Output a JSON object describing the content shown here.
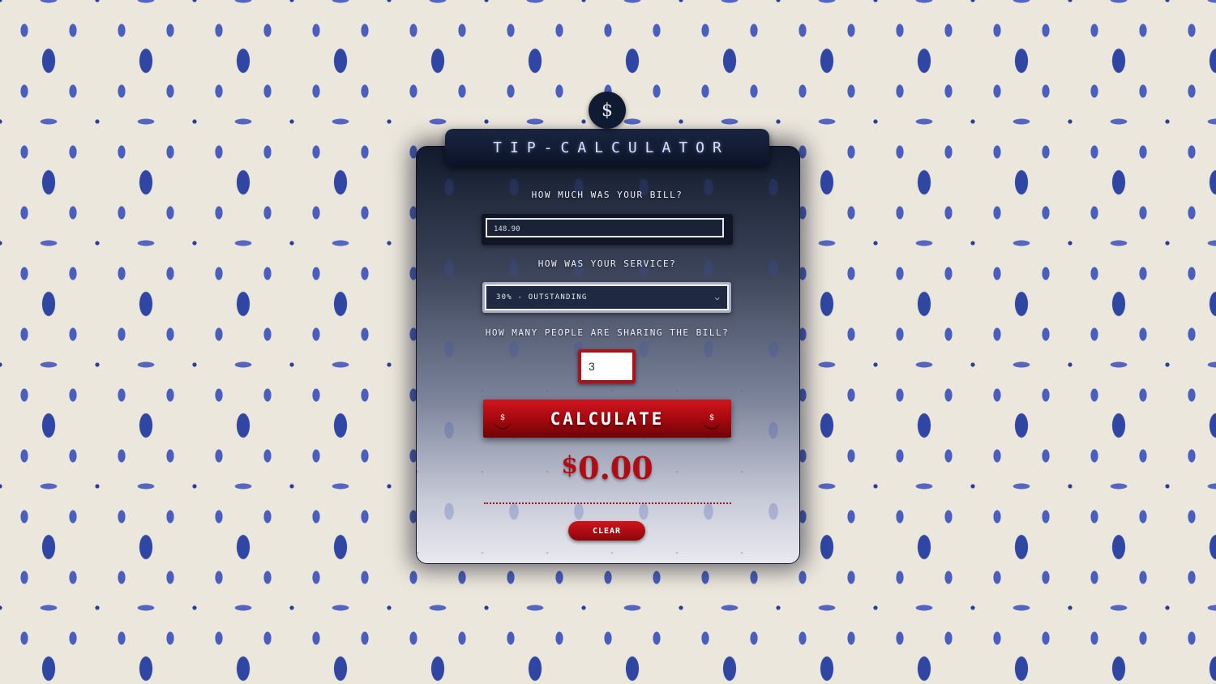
{
  "app": {
    "title": "Tip-Calculator",
    "logo_icon": "dollar-coin-icon",
    "logo_symbol": "$"
  },
  "form": {
    "bill_label": "How much was your bill?",
    "bill_value": "148.90",
    "service_label": "How was your service?",
    "service_selected": "30% - Outstanding",
    "people_label": "How many people are sharing the bill?",
    "people_value": "3"
  },
  "actions": {
    "calculate_label": "Calculate",
    "calculate_icon_symbol": "$",
    "clear_label": "Clear"
  },
  "result": {
    "currency_symbol": "$",
    "amount": "0.00"
  },
  "colors": {
    "accent_red": "#b10c14",
    "panel_navy": "#121a2e",
    "pattern_blue": "#2f46a3",
    "pattern_cream": "#ece7dc"
  }
}
